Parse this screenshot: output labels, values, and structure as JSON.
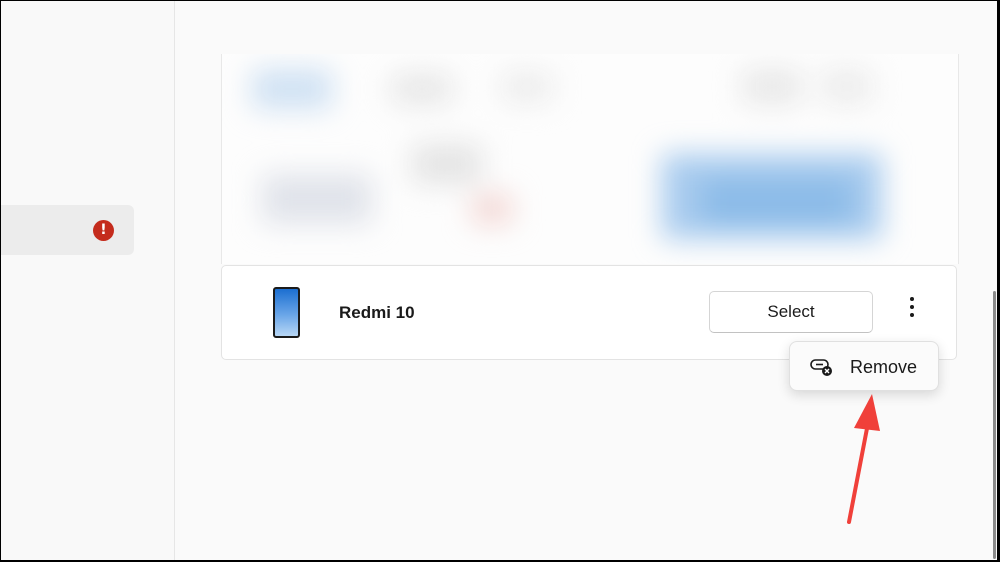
{
  "device": {
    "name": "Redmi 10",
    "select_label": "Select"
  },
  "menu": {
    "remove_label": "Remove"
  },
  "icons": {
    "alert": "alert-circle-icon",
    "phone": "phone-icon",
    "more": "more-vertical-icon",
    "remove": "link-remove-icon"
  },
  "colors": {
    "alert": "#c42b1c",
    "annotation_arrow": "#f0403a",
    "phone_screen": "#1c6fd1"
  }
}
